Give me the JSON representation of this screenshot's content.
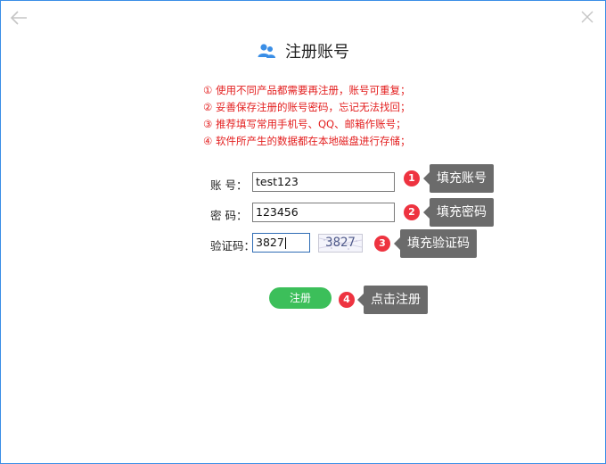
{
  "window": {
    "title": "注册账号"
  },
  "notes": [
    "① 使用不同产品都需要再注册，账号可重复；",
    "② 妥善保存注册的账号密码，忘记无法找回；",
    "③ 推荐填写常用手机号、QQ、邮箱作账号；",
    "④ 软件所产生的数据都在本地磁盘进行存储；"
  ],
  "form": {
    "account_label": "账  号：",
    "account_value": "test123",
    "password_label": "密  码：",
    "password_value": "123456",
    "captcha_label": "验证码：",
    "captcha_value": "3827",
    "captcha_image_text": "3827",
    "submit_label": "注册"
  },
  "tips": [
    {
      "number": "1",
      "text": "填充账号"
    },
    {
      "number": "2",
      "text": "填充密码"
    },
    {
      "number": "3",
      "text": "填充验证码"
    },
    {
      "number": "4",
      "text": "点击注册"
    }
  ],
  "colors": {
    "accent": "#3a8ee6",
    "notice": "#e31e1e",
    "submit": "#3cbf5a",
    "step_badge": "#ee3340",
    "tip_bg": "#6b6b6b"
  },
  "icons": {
    "back": "arrow-left-icon",
    "close": "close-icon",
    "title": "users-icon"
  }
}
